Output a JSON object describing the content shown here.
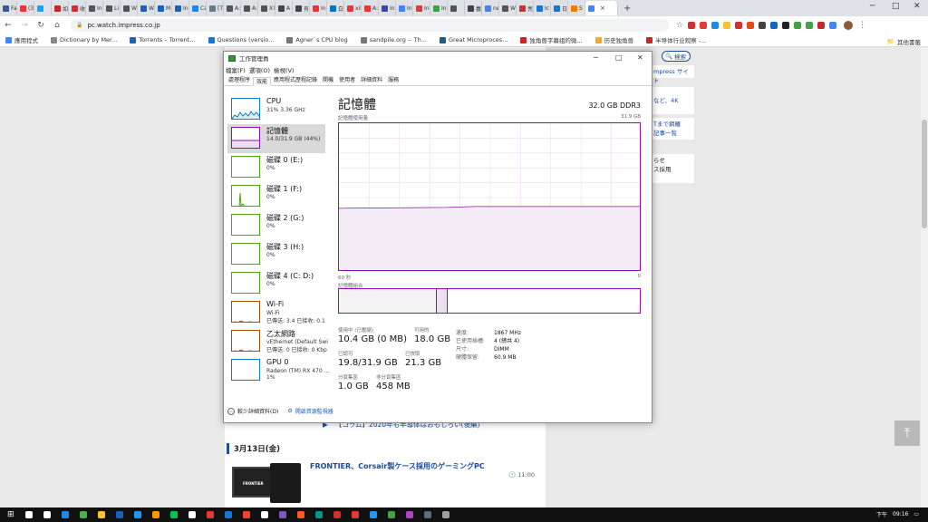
{
  "browser": {
    "tabs": [
      {
        "label": "Fa",
        "color": "#3b5998"
      },
      {
        "label": "(3",
        "color": "#e53935"
      },
      {
        "label": "",
        "color": "#1da1f2"
      },
      {
        "label": "如",
        "color": "#c62828"
      },
      {
        "label": "收",
        "color": "#d32f2f"
      },
      {
        "label": "In",
        "color": "#555555"
      },
      {
        "label": "Li",
        "color": "#555555"
      },
      {
        "label": "W",
        "color": "#555555"
      },
      {
        "label": "Wi",
        "color": "#1565c0"
      },
      {
        "label": "M",
        "color": "#1565c0"
      },
      {
        "label": "In",
        "color": "#1565c0"
      },
      {
        "label": "Ca",
        "color": "#1e88e5"
      },
      {
        "label": "[T",
        "color": "#607d8b"
      },
      {
        "label": "A:",
        "color": "#555555"
      },
      {
        "label": "A:",
        "color": "#555555"
      },
      {
        "label": "X!",
        "color": "#555555"
      },
      {
        "label": "A",
        "color": "#444444"
      },
      {
        "label": "有",
        "color": "#444444"
      },
      {
        "label": "In",
        "color": "#e53935"
      },
      {
        "label": "白",
        "color": "#0277bd"
      },
      {
        "label": "xil",
        "color": "#e53935"
      },
      {
        "label": "A:",
        "color": "#e53935"
      },
      {
        "label": "In",
        "color": "#3949ab"
      },
      {
        "label": "In",
        "color": "#4285f4"
      },
      {
        "label": "In",
        "color": "#e53935"
      },
      {
        "label": "In",
        "color": "#43a047"
      },
      {
        "label": "",
        "color": "#555555"
      },
      {
        "label": "義",
        "color": "#444444"
      },
      {
        "label": "ne",
        "color": "#4285f4"
      },
      {
        "label": "W",
        "color": "#555555"
      },
      {
        "label": "亮",
        "color": "#d32f2f"
      },
      {
        "label": "Ic",
        "color": "#1976d2"
      },
      {
        "label": "日",
        "color": "#1976d2"
      },
      {
        "label": "S",
        "color": "#f57c00"
      },
      {
        "label": "",
        "color": "#4285f4"
      }
    ],
    "active_tab_close": "×",
    "new_tab": "+",
    "window_controls": {
      "minimize": "─",
      "maximize": "□",
      "close": "✕"
    },
    "nav": {
      "back": "←",
      "forward": "→",
      "reload": "↻",
      "home": "⌂"
    },
    "url": "pc.watch.impress.co.jp",
    "star": "☆",
    "menu": "⋮",
    "extensions": [
      "#d32f2f",
      "#e53935",
      "#1e88e5",
      "#fbc02d",
      "#d32f2f",
      "#e64a19",
      "#424242",
      "#1565c0",
      "#222222",
      "#43a047",
      "#43a047",
      "#c62828",
      "#4285f4"
    ],
    "bookmarks": [
      {
        "label": "應用程式",
        "color": "#4285f4"
      },
      {
        "label": "Dictionary by Mer...",
        "color": "#888888"
      },
      {
        "label": "Torrents – Torrent...",
        "color": "#1565c0"
      },
      {
        "label": "Questions (versio...",
        "color": "#1976d2"
      },
      {
        "label": "Agner`s CPU blog",
        "color": "#777777"
      },
      {
        "label": "sandpile.org -- Th...",
        "color": "#777777"
      },
      {
        "label": "Great Microproces...",
        "color": "#1e5d8a"
      },
      {
        "label": "独角兽字幕组的微...",
        "color": "#c62828"
      },
      {
        "label": "历史独角兽",
        "color": "#f9a825"
      },
      {
        "label": "半导体行业观察 -...",
        "color": "#c62828"
      }
    ],
    "other_bookmarks": "其他書籤"
  },
  "page": {
    "right_snippets": [
      "mpress サイト",
      "など、4K",
      "Tまで網羅\n記事一覧",
      "らせ\nス採用"
    ],
    "search_button": "検索",
    "headline_partial": "【コラム】2020年も半導体はおもしろい(後編)",
    "date_heading": "3月13日(金)",
    "card_title": "FRONTIER、Corsair製ケース採用のゲーミングPC",
    "card_time": "11:00",
    "card_brand": "FRONTIER",
    "to_top": "へ"
  },
  "taskmgr": {
    "title": "工作管理員",
    "menu": [
      "檔案(F)",
      "選項(O)",
      "檢視(V)"
    ],
    "tabs": [
      "處理程序",
      "效能",
      "應用程式歷程記錄",
      "開機",
      "使用者",
      "詳細資料",
      "服務"
    ],
    "active_tab": 1,
    "resources": [
      {
        "name": "CPU",
        "sub": "31% 3.36 GHz",
        "sub2": "",
        "color": "#117dbb",
        "selected": false
      },
      {
        "name": "記憶體",
        "sub": "14.0/31.9 GB (44%)",
        "sub2": "",
        "color": "#8b12ae",
        "selected": true
      },
      {
        "name": "磁碟 0 (E:)",
        "sub": "0%",
        "sub2": "",
        "color": "#4da60c",
        "selected": false
      },
      {
        "name": "磁碟 1 (F:)",
        "sub": "0%",
        "sub2": "",
        "color": "#4da60c",
        "selected": false
      },
      {
        "name": "磁碟 2 (G:)",
        "sub": "0%",
        "sub2": "",
        "color": "#4da60c",
        "selected": false
      },
      {
        "name": "磁碟 3 (H:)",
        "sub": "0%",
        "sub2": "",
        "color": "#4da60c",
        "selected": false
      },
      {
        "name": "磁碟 4 (C: D:)",
        "sub": "0%",
        "sub2": "",
        "color": "#4da60c",
        "selected": false
      },
      {
        "name": "Wi-Fi",
        "sub": "Wi-Fi",
        "sub2": "已傳送: 3.4 已接收: 0.1",
        "color": "#a74f01",
        "selected": false
      },
      {
        "name": "乙太網路",
        "sub": "vEthernet (Default Swi",
        "sub2": "已傳送: 0 已接收: 0 Kbp",
        "color": "#a74f01",
        "selected": false
      },
      {
        "name": "GPU 0",
        "sub": "Radeon (TM) RX 470 ...",
        "sub2": "1%",
        "color": "#117dbb",
        "selected": false
      }
    ],
    "memory": {
      "title": "記憶體",
      "spec": "32.0 GB DDR3",
      "usage_label": "記憶體使用量",
      "usage_max": "31.9 GB",
      "axis_left": "60 秒",
      "axis_right": "0",
      "composition_label": "記憶體組合",
      "usage_fraction": 0.44,
      "composition": {
        "in_use_fraction": 0.326,
        "modified_fraction": 0.035
      },
      "stats": [
        {
          "label": "使用中 (已壓縮)",
          "value": "10.4 GB (0 MB)"
        },
        {
          "label": "可用的",
          "value": "18.0 GB"
        },
        {
          "label": "已認可",
          "value": "19.8/31.9 GB"
        },
        {
          "label": "已快取",
          "value": "21.3 GB"
        },
        {
          "label": "分頁集區",
          "value": "1.0 GB"
        },
        {
          "label": "非分頁集區",
          "value": "458 MB"
        }
      ],
      "props": [
        {
          "k": "速度:",
          "v": "1867 MHz"
        },
        {
          "k": "已使用插槽:",
          "v": "4 (總共 4)"
        },
        {
          "k": "尺寸:",
          "v": "DIMM"
        },
        {
          "k": "硬體保留:",
          "v": "60.9 MB"
        }
      ]
    },
    "footer": {
      "fewer": "較少詳細資料(D)",
      "open_monitor": "開啟資源監視器"
    }
  },
  "taskbar": {
    "icons": [
      "#ffffff",
      "#ffffff",
      "#1e88e5",
      "#4caf50",
      "#fbc02d",
      "#1565c0",
      "#2196f3",
      "#ff9800",
      "#00c853",
      "#ffffff",
      "#e53935",
      "#1976d2",
      "#f44336",
      "#ffffff",
      "#7e57c2",
      "#ff5722",
      "#009688",
      "#d32f2f",
      "#e53935",
      "#2196f3",
      "#43a047",
      "#ab47bc",
      "#546e7a",
      "#9e9e9e"
    ],
    "time": "09:16",
    "ampm": "下午"
  }
}
